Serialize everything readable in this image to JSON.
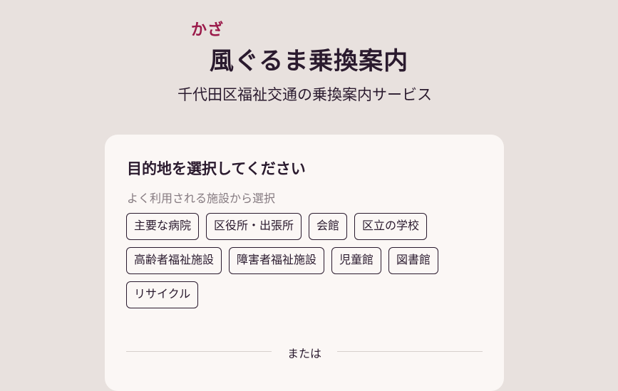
{
  "header": {
    "ruby": "かざ",
    "title": "風ぐるま乗換案内",
    "subtitle": "千代田区福祉交通の乗換案内サービス"
  },
  "card": {
    "title": "目的地を選択してください",
    "hint": "よく利用される施設から選択",
    "chips": [
      "主要な病院",
      "区役所・出張所",
      "会館",
      "区立の学校",
      "高齢者福祉施設",
      "障害者福祉施設",
      "児童館",
      "図書館",
      "リサイクル"
    ],
    "divider_text": "または"
  },
  "colors": {
    "background": "#e8e1de",
    "card": "#fbf7f5",
    "accent": "#9b1b4b",
    "text": "#2a1a2e",
    "muted": "#857a80"
  }
}
